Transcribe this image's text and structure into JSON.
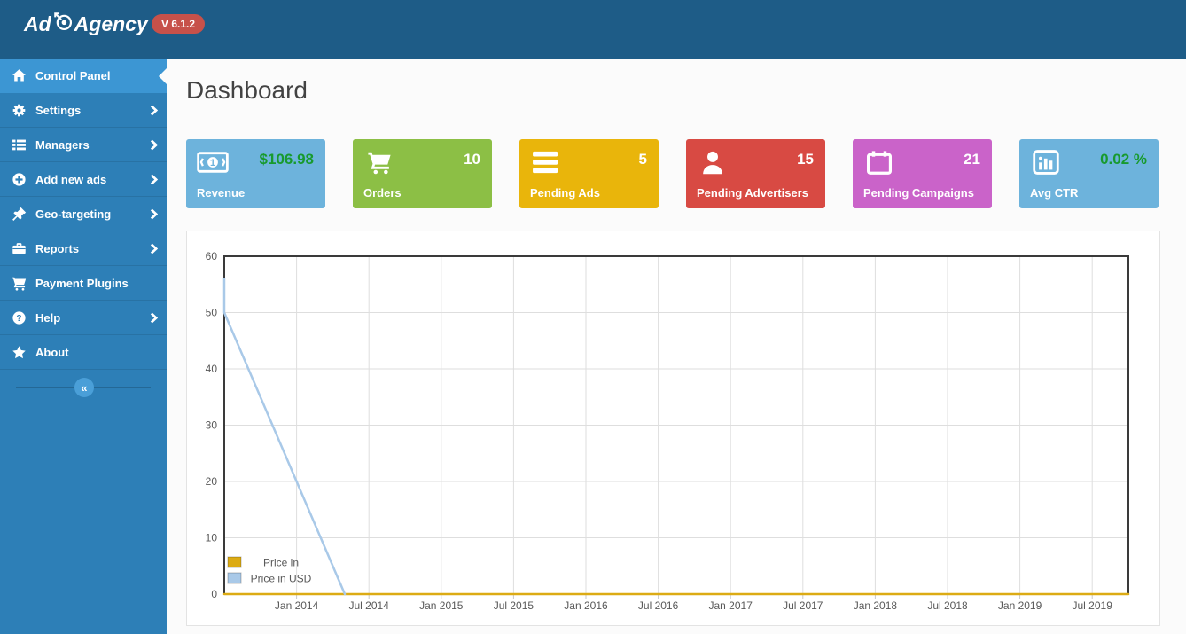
{
  "header": {
    "logo_prefix": "Ad",
    "logo_suffix": "Agency",
    "version_badge": "V 6.1.2"
  },
  "sidebar": {
    "items": [
      {
        "label": "Control Panel",
        "icon": "home-icon",
        "active": true,
        "chevron": false
      },
      {
        "label": "Settings",
        "icon": "gear-icon",
        "active": false,
        "chevron": true
      },
      {
        "label": "Managers",
        "icon": "list-icon",
        "active": false,
        "chevron": true
      },
      {
        "label": "Add new ads",
        "icon": "plus-circle-icon",
        "active": false,
        "chevron": true
      },
      {
        "label": "Geo-targeting",
        "icon": "pin-icon",
        "active": false,
        "chevron": true
      },
      {
        "label": "Reports",
        "icon": "briefcase-icon",
        "active": false,
        "chevron": true
      },
      {
        "label": "Payment Plugins",
        "icon": "cart-icon",
        "active": false,
        "chevron": false
      },
      {
        "label": "Help",
        "icon": "question-circle-icon",
        "active": false,
        "chevron": true
      },
      {
        "label": "About",
        "icon": "star-icon",
        "active": false,
        "chevron": false
      }
    ],
    "collapse_icon": "«"
  },
  "main": {
    "page_title": "Dashboard",
    "stat_cards": [
      {
        "label": "Revenue",
        "value": "$106.98",
        "icon": "banknote-icon",
        "bg": "#6db3dc",
        "value_color": "#189a2e"
      },
      {
        "label": "Orders",
        "value": "10",
        "icon": "cart-icon",
        "bg": "#8cbf45",
        "value_color": "#ffffff"
      },
      {
        "label": "Pending Ads",
        "value": "5",
        "icon": "bars-icon",
        "bg": "#e9b50b",
        "value_color": "#ffffff"
      },
      {
        "label": "Pending Advertisers",
        "value": "15",
        "icon": "user-icon",
        "bg": "#d84a43",
        "value_color": "#ffffff"
      },
      {
        "label": "Pending Campaigns",
        "value": "21",
        "icon": "calendar-icon",
        "bg": "#ca63c9",
        "value_color": "#ffffff"
      },
      {
        "label": "Avg CTR",
        "value": "0.02 %",
        "icon": "bar-chart-icon",
        "bg": "#6db3dc",
        "value_color": "#189a2e"
      }
    ]
  },
  "chart_data": {
    "type": "line",
    "title": "",
    "xlabel": "",
    "ylabel": "",
    "ylim": [
      0,
      60
    ],
    "y_ticks": [
      0,
      10,
      20,
      30,
      40,
      50,
      60
    ],
    "x_tick_labels": [
      "Jan 2014",
      "Jul 2014",
      "Jan 2015",
      "Jul 2015",
      "Jan 2016",
      "Jul 2016",
      "Jan 2017",
      "Jul 2017",
      "Jan 2018",
      "Jul 2018",
      "Jan 2019",
      "Jul 2019"
    ],
    "x_range_months": [
      "2013-07",
      "2019-10"
    ],
    "grid": true,
    "legend_position": "bottom-left",
    "series": [
      {
        "name": "Price in",
        "color": "#dcab14",
        "points": [
          [
            "2013-07",
            0
          ],
          [
            "2019-10",
            0
          ]
        ]
      },
      {
        "name": "Price in USD",
        "color": "#a9c9e8",
        "points": [
          [
            "2013-07",
            56
          ],
          [
            "2013-07",
            50
          ],
          [
            "2014-05",
            0
          ]
        ]
      }
    ]
  }
}
